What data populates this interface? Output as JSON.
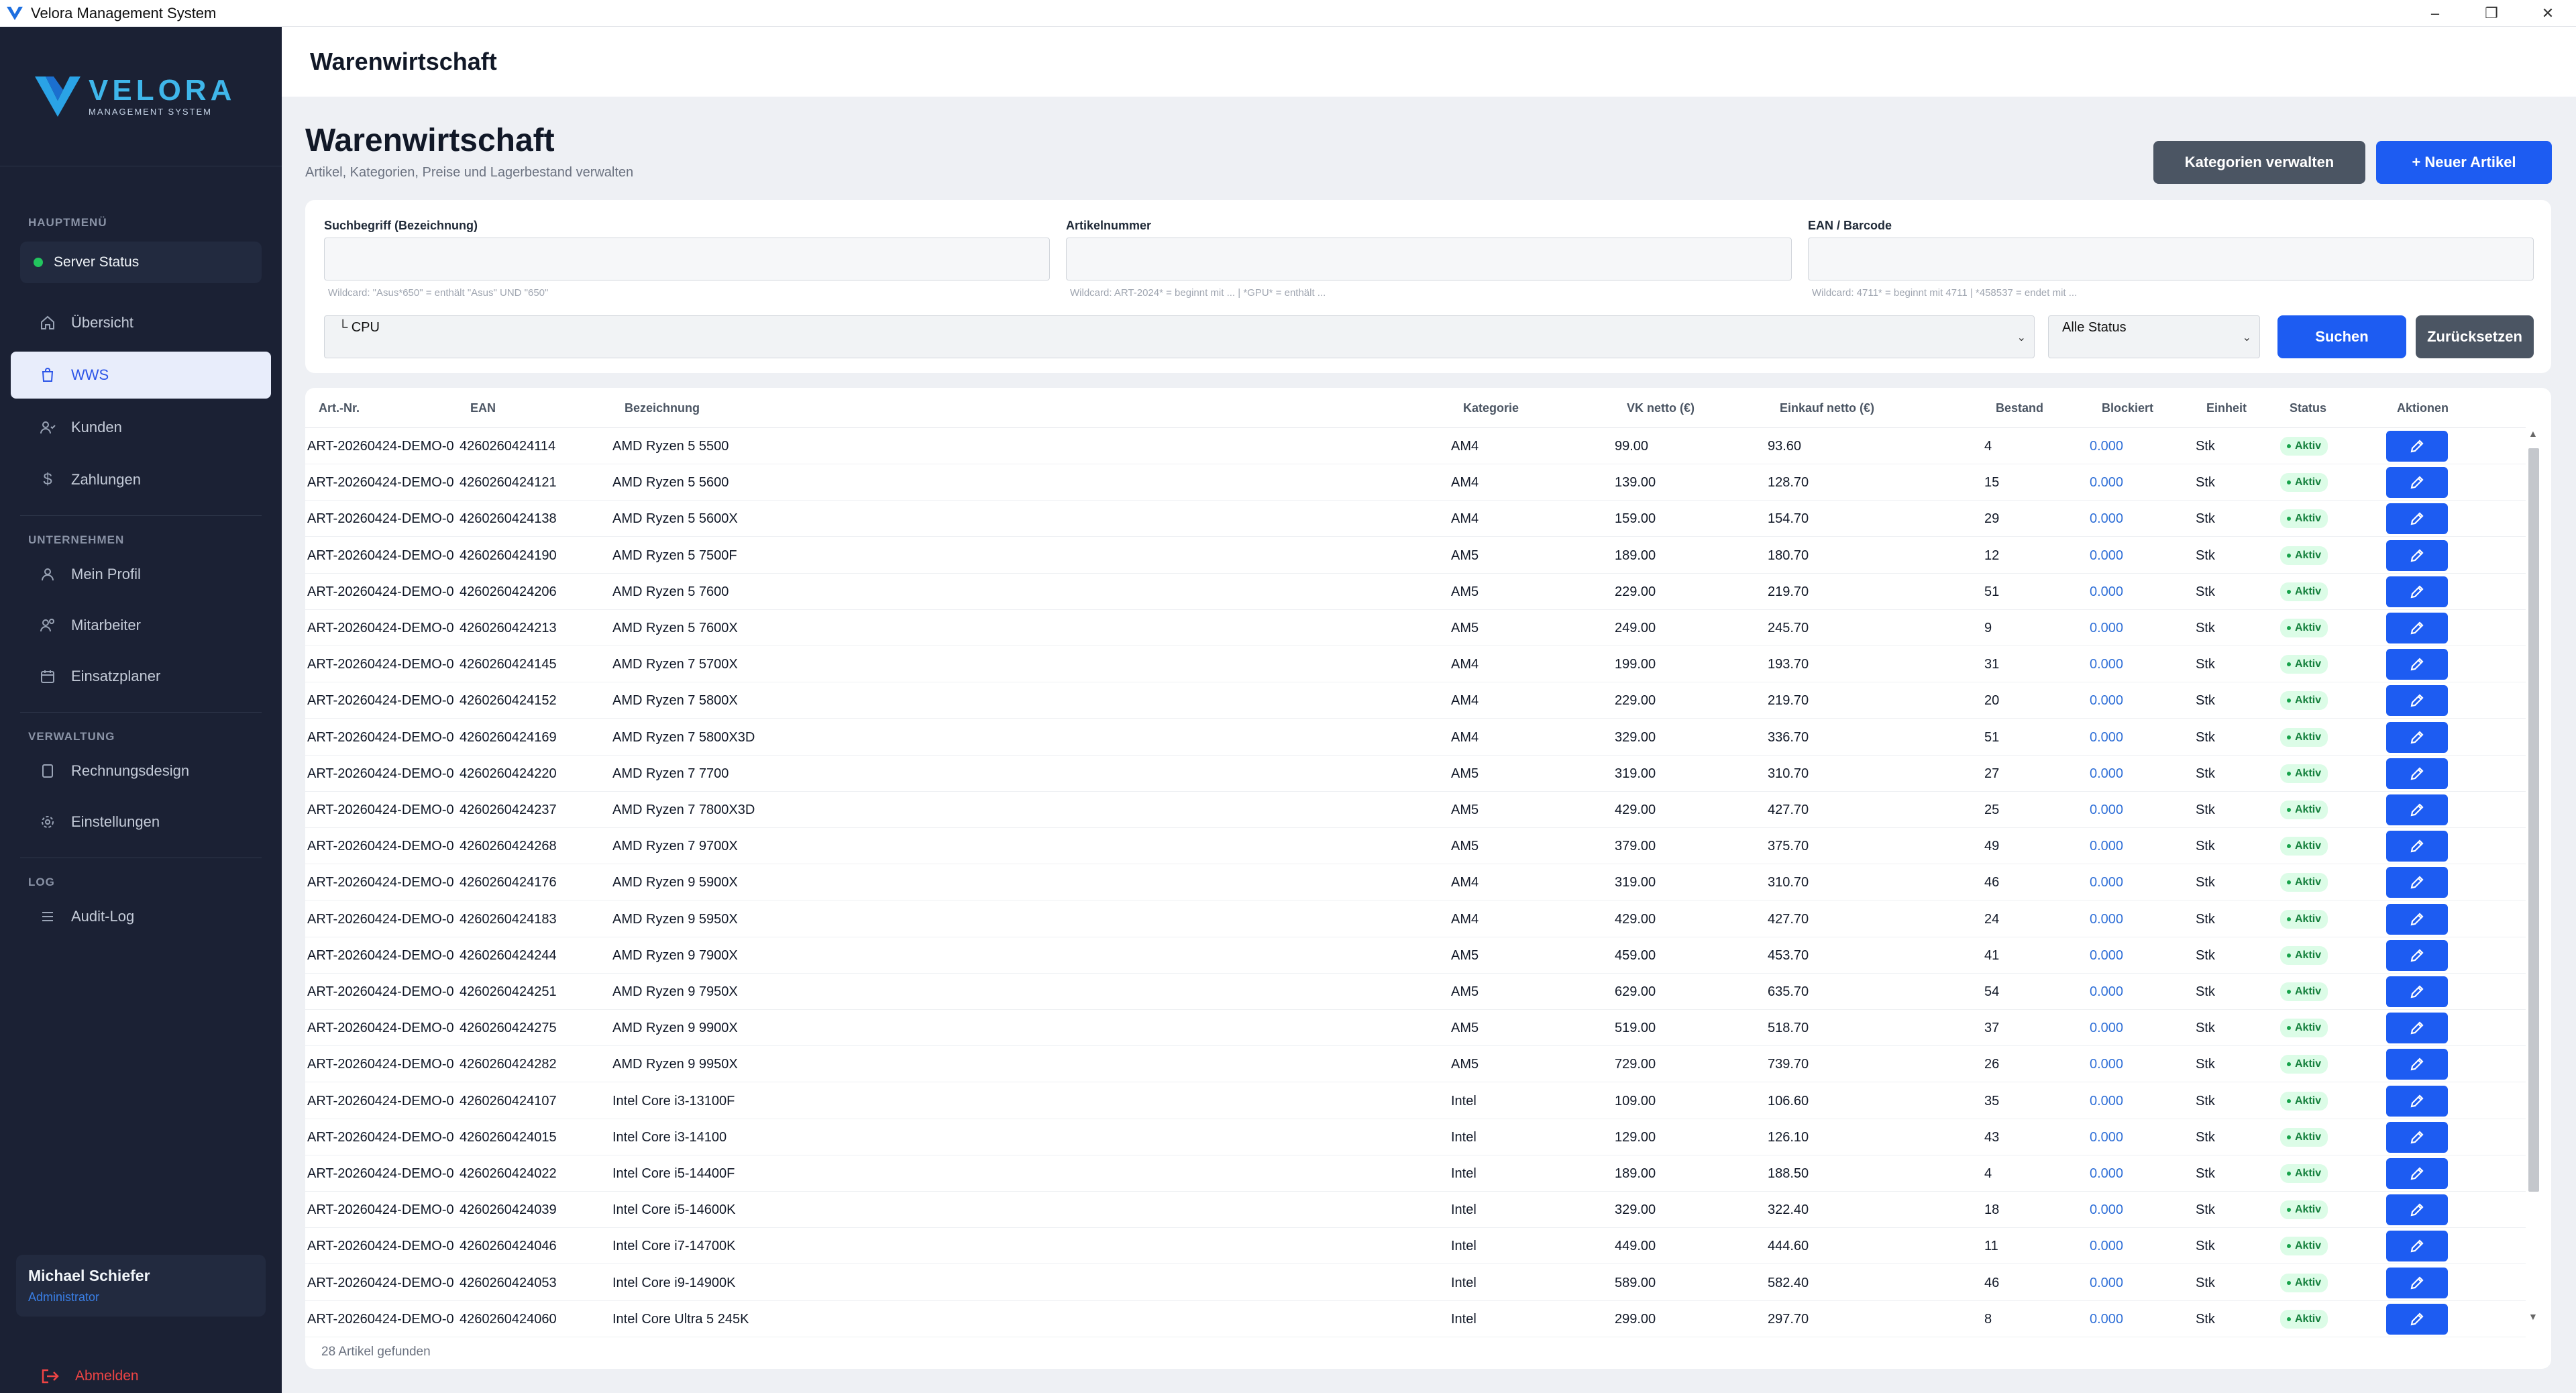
{
  "window": {
    "title": "Velora Management System"
  },
  "brand": {
    "name": "VELORA",
    "sub": "MANAGEMENT SYSTEM"
  },
  "sidebar": {
    "sections": {
      "main": "HAUPTMENÜ",
      "company": "UNTERNEHMEN",
      "admin": "VERWALTUNG",
      "log": "LOG"
    },
    "server_status": "Server Status",
    "items": {
      "overview": "Übersicht",
      "wws": "WWS",
      "customers": "Kunden",
      "payments": "Zahlungen",
      "profile": "Mein Profil",
      "employees": "Mitarbeiter",
      "planner": "Einsatzplaner",
      "invoice_design": "Rechnungsdesign",
      "settings": "Einstellungen",
      "audit_log": "Audit-Log"
    },
    "user": {
      "name": "Michael Schiefer",
      "role": "Administrator"
    },
    "logout": "Abmelden"
  },
  "header": {
    "title": "Warenwirtschaft"
  },
  "main": {
    "title": "Warenwirtschaft",
    "subtitle": "Artikel, Kategorien, Preise und Lagerbestand verwalten",
    "buttons": {
      "categories": "Kategorien verwalten",
      "new_article": "+ Neuer Artikel"
    }
  },
  "filters": {
    "search_label": "Suchbegriff (Bezeichnung)",
    "search_hint": "Wildcard: \"Asus*650\" = enthält \"Asus\" UND \"650\"",
    "article_label": "Artikelnummer",
    "article_hint": "Wildcard: ART-2024* = beginnt mit ... | *GPU* = enthält ...",
    "ean_label": "EAN / Barcode",
    "ean_hint": "Wildcard: 4711* = beginnt mit 4711 | *458537 = endet mit ...",
    "category_selected": "└ CPU",
    "status_selected": "Alle Status",
    "search_button": "Suchen",
    "reset_button": "Zurücksetzen"
  },
  "table": {
    "headers": {
      "art_nr": "Art.-Nr.",
      "ean": "EAN",
      "name": "Bezeichnung",
      "category": "Kategorie",
      "vk": "VK netto (€)",
      "ek": "Einkauf netto (€)",
      "stock": "Bestand",
      "blocked": "Blockiert",
      "unit": "Einheit",
      "status": "Status",
      "actions": "Aktionen"
    },
    "rows": [
      {
        "art": "ART-20260424-DEMO-0",
        "ean": "4260260424114",
        "name": "AMD Ryzen 5 5500",
        "cat": "AM4",
        "vk": "99.00",
        "ek": "93.60",
        "stock": "4",
        "blocked": "0.000",
        "unit": "Stk",
        "status": "Aktiv"
      },
      {
        "art": "ART-20260424-DEMO-0",
        "ean": "4260260424121",
        "name": "AMD Ryzen 5 5600",
        "cat": "AM4",
        "vk": "139.00",
        "ek": "128.70",
        "stock": "15",
        "blocked": "0.000",
        "unit": "Stk",
        "status": "Aktiv"
      },
      {
        "art": "ART-20260424-DEMO-0",
        "ean": "4260260424138",
        "name": "AMD Ryzen 5 5600X",
        "cat": "AM4",
        "vk": "159.00",
        "ek": "154.70",
        "stock": "29",
        "blocked": "0.000",
        "unit": "Stk",
        "status": "Aktiv"
      },
      {
        "art": "ART-20260424-DEMO-0",
        "ean": "4260260424190",
        "name": "AMD Ryzen 5 7500F",
        "cat": "AM5",
        "vk": "189.00",
        "ek": "180.70",
        "stock": "12",
        "blocked": "0.000",
        "unit": "Stk",
        "status": "Aktiv"
      },
      {
        "art": "ART-20260424-DEMO-0",
        "ean": "4260260424206",
        "name": "AMD Ryzen 5 7600",
        "cat": "AM5",
        "vk": "229.00",
        "ek": "219.70",
        "stock": "51",
        "blocked": "0.000",
        "unit": "Stk",
        "status": "Aktiv"
      },
      {
        "art": "ART-20260424-DEMO-0",
        "ean": "4260260424213",
        "name": "AMD Ryzen 5 7600X",
        "cat": "AM5",
        "vk": "249.00",
        "ek": "245.70",
        "stock": "9",
        "blocked": "0.000",
        "unit": "Stk",
        "status": "Aktiv"
      },
      {
        "art": "ART-20260424-DEMO-0",
        "ean": "4260260424145",
        "name": "AMD Ryzen 7 5700X",
        "cat": "AM4",
        "vk": "199.00",
        "ek": "193.70",
        "stock": "31",
        "blocked": "0.000",
        "unit": "Stk",
        "status": "Aktiv"
      },
      {
        "art": "ART-20260424-DEMO-0",
        "ean": "4260260424152",
        "name": "AMD Ryzen 7 5800X",
        "cat": "AM4",
        "vk": "229.00",
        "ek": "219.70",
        "stock": "20",
        "blocked": "0.000",
        "unit": "Stk",
        "status": "Aktiv"
      },
      {
        "art": "ART-20260424-DEMO-0",
        "ean": "4260260424169",
        "name": "AMD Ryzen 7 5800X3D",
        "cat": "AM4",
        "vk": "329.00",
        "ek": "336.70",
        "stock": "51",
        "blocked": "0.000",
        "unit": "Stk",
        "status": "Aktiv"
      },
      {
        "art": "ART-20260424-DEMO-0",
        "ean": "4260260424220",
        "name": "AMD Ryzen 7 7700",
        "cat": "AM5",
        "vk": "319.00",
        "ek": "310.70",
        "stock": "27",
        "blocked": "0.000",
        "unit": "Stk",
        "status": "Aktiv"
      },
      {
        "art": "ART-20260424-DEMO-0",
        "ean": "4260260424237",
        "name": "AMD Ryzen 7 7800X3D",
        "cat": "AM5",
        "vk": "429.00",
        "ek": "427.70",
        "stock": "25",
        "blocked": "0.000",
        "unit": "Stk",
        "status": "Aktiv"
      },
      {
        "art": "ART-20260424-DEMO-0",
        "ean": "4260260424268",
        "name": "AMD Ryzen 7 9700X",
        "cat": "AM5",
        "vk": "379.00",
        "ek": "375.70",
        "stock": "49",
        "blocked": "0.000",
        "unit": "Stk",
        "status": "Aktiv"
      },
      {
        "art": "ART-20260424-DEMO-0",
        "ean": "4260260424176",
        "name": "AMD Ryzen 9 5900X",
        "cat": "AM4",
        "vk": "319.00",
        "ek": "310.70",
        "stock": "46",
        "blocked": "0.000",
        "unit": "Stk",
        "status": "Aktiv"
      },
      {
        "art": "ART-20260424-DEMO-0",
        "ean": "4260260424183",
        "name": "AMD Ryzen 9 5950X",
        "cat": "AM4",
        "vk": "429.00",
        "ek": "427.70",
        "stock": "24",
        "blocked": "0.000",
        "unit": "Stk",
        "status": "Aktiv"
      },
      {
        "art": "ART-20260424-DEMO-0",
        "ean": "4260260424244",
        "name": "AMD Ryzen 9 7900X",
        "cat": "AM5",
        "vk": "459.00",
        "ek": "453.70",
        "stock": "41",
        "blocked": "0.000",
        "unit": "Stk",
        "status": "Aktiv"
      },
      {
        "art": "ART-20260424-DEMO-0",
        "ean": "4260260424251",
        "name": "AMD Ryzen 9 7950X",
        "cat": "AM5",
        "vk": "629.00",
        "ek": "635.70",
        "stock": "54",
        "blocked": "0.000",
        "unit": "Stk",
        "status": "Aktiv"
      },
      {
        "art": "ART-20260424-DEMO-0",
        "ean": "4260260424275",
        "name": "AMD Ryzen 9 9900X",
        "cat": "AM5",
        "vk": "519.00",
        "ek": "518.70",
        "stock": "37",
        "blocked": "0.000",
        "unit": "Stk",
        "status": "Aktiv"
      },
      {
        "art": "ART-20260424-DEMO-0",
        "ean": "4260260424282",
        "name": "AMD Ryzen 9 9950X",
        "cat": "AM5",
        "vk": "729.00",
        "ek": "739.70",
        "stock": "26",
        "blocked": "0.000",
        "unit": "Stk",
        "status": "Aktiv"
      },
      {
        "art": "ART-20260424-DEMO-0",
        "ean": "4260260424107",
        "name": "Intel Core i3-13100F",
        "cat": "Intel",
        "vk": "109.00",
        "ek": "106.60",
        "stock": "35",
        "blocked": "0.000",
        "unit": "Stk",
        "status": "Aktiv"
      },
      {
        "art": "ART-20260424-DEMO-0",
        "ean": "4260260424015",
        "name": "Intel Core i3-14100",
        "cat": "Intel",
        "vk": "129.00",
        "ek": "126.10",
        "stock": "43",
        "blocked": "0.000",
        "unit": "Stk",
        "status": "Aktiv"
      },
      {
        "art": "ART-20260424-DEMO-0",
        "ean": "4260260424022",
        "name": "Intel Core i5-14400F",
        "cat": "Intel",
        "vk": "189.00",
        "ek": "188.50",
        "stock": "4",
        "blocked": "0.000",
        "unit": "Stk",
        "status": "Aktiv"
      },
      {
        "art": "ART-20260424-DEMO-0",
        "ean": "4260260424039",
        "name": "Intel Core i5-14600K",
        "cat": "Intel",
        "vk": "329.00",
        "ek": "322.40",
        "stock": "18",
        "blocked": "0.000",
        "unit": "Stk",
        "status": "Aktiv"
      },
      {
        "art": "ART-20260424-DEMO-0",
        "ean": "4260260424046",
        "name": "Intel Core i7-14700K",
        "cat": "Intel",
        "vk": "449.00",
        "ek": "444.60",
        "stock": "11",
        "blocked": "0.000",
        "unit": "Stk",
        "status": "Aktiv"
      },
      {
        "art": "ART-20260424-DEMO-0",
        "ean": "4260260424053",
        "name": "Intel Core i9-14900K",
        "cat": "Intel",
        "vk": "589.00",
        "ek": "582.40",
        "stock": "46",
        "blocked": "0.000",
        "unit": "Stk",
        "status": "Aktiv"
      },
      {
        "art": "ART-20260424-DEMO-0",
        "ean": "4260260424060",
        "name": "Intel Core Ultra 5 245K",
        "cat": "Intel",
        "vk": "299.00",
        "ek": "297.70",
        "stock": "8",
        "blocked": "0.000",
        "unit": "Stk",
        "status": "Aktiv"
      }
    ],
    "footer": "28 Artikel gefunden"
  },
  "colors": {
    "sidebar_bg": "#1b2134",
    "accent": "#1d5cf2",
    "brand": "#3fb6ea",
    "active_status": "#15803d",
    "logout": "#ef4444"
  }
}
